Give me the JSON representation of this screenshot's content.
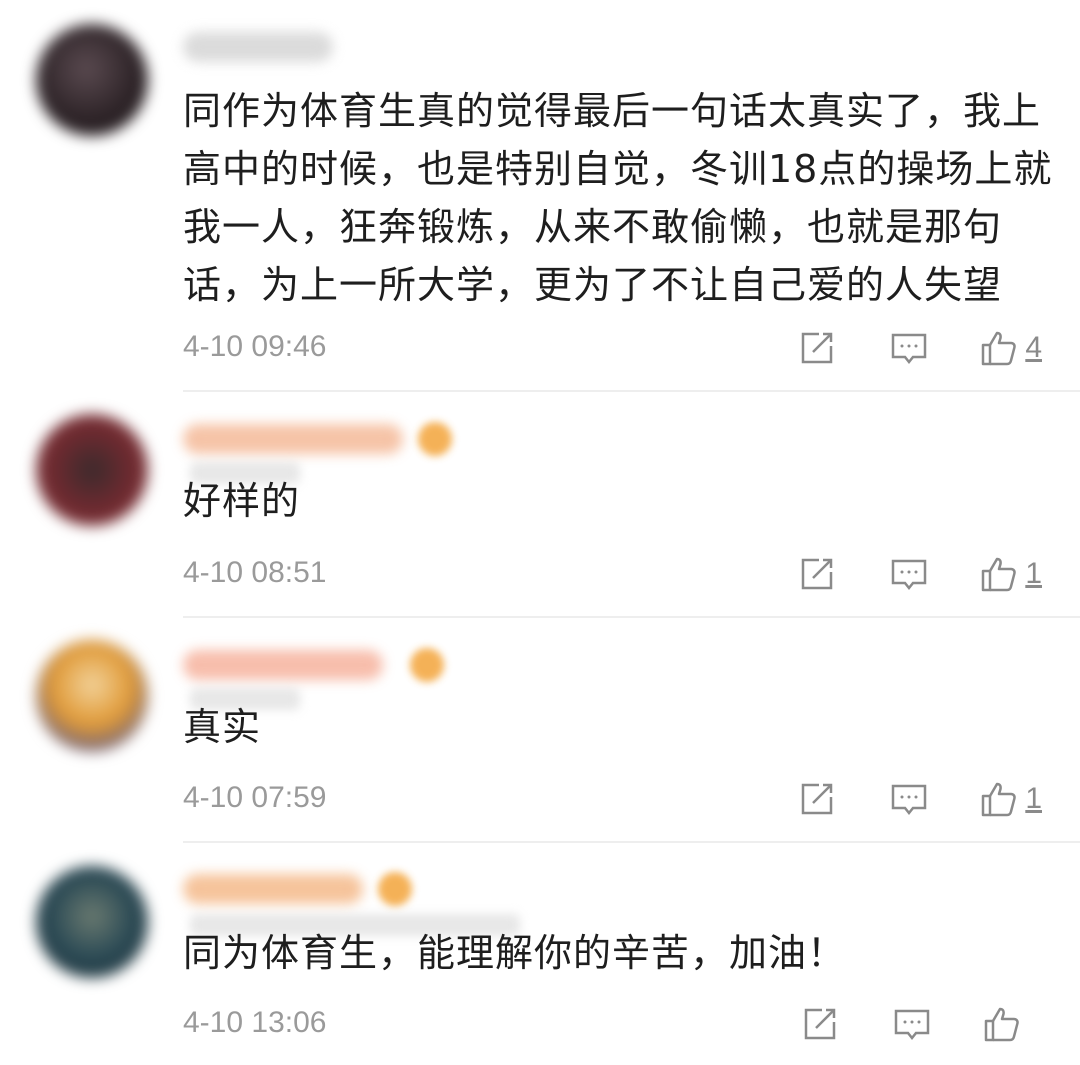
{
  "comments": [
    {
      "text": "同作为体育生真的觉得最后一句话太真实了，我上高中的时候，也是特别自觉，冬训18点的操场上就我一人，狂奔锻炼，从来不敢偷懒，也就是那句话，为上一所大学，更为了不让自己爱的人失望",
      "time": "4-10 09:46",
      "likes": "4",
      "colors": {
        "avatar": "#3a3035",
        "name": "#cfcfcf"
      }
    },
    {
      "text": "好样的",
      "time": "4-10 08:51",
      "likes": "1",
      "colors": {
        "avatar": "#7a2a30",
        "name": "#f3b08a"
      }
    },
    {
      "text": "真实",
      "time": "4-10 07:59",
      "likes": "1",
      "colors": {
        "avatar": "#e3a040",
        "name": "#f5a890"
      }
    },
    {
      "text": "同为体育生，能理解你的辛苦，加油！",
      "time": "4-10 13:06",
      "likes": "",
      "colors": {
        "avatar": "#2b4a55",
        "name": "#f3b07a"
      }
    }
  ],
  "icons": {
    "share": "share-icon",
    "reply": "comment-icon",
    "like": "thumbs-up-icon"
  }
}
